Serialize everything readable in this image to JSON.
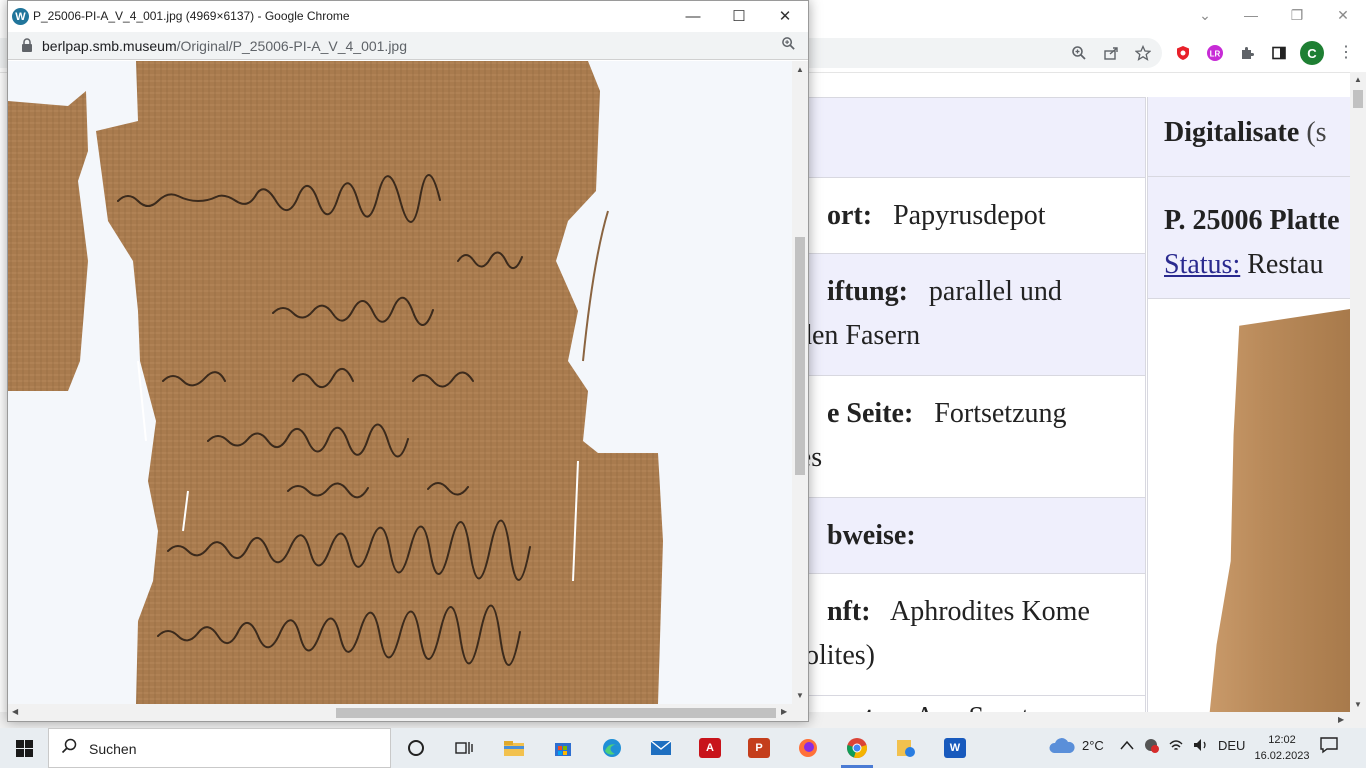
{
  "bg_window": {
    "controls": {
      "chevron": "⌄",
      "minimize": "—",
      "restore": "❐",
      "close": "✕"
    },
    "toolbar_icons": [
      "zoom-icon",
      "share-icon",
      "star-icon",
      "shield-extension-icon",
      "lr-extension-icon",
      "puzzle-icon",
      "side-panel-icon"
    ],
    "avatar_letter": "C",
    "table_rows": [
      {
        "label": "ort:",
        "value": "Papyrusdepot"
      },
      {
        "label": "iftung:",
        "value": "parallel und",
        "value2": "u den Fasern"
      },
      {
        "label": "e Seite:",
        "value": "Fortsetzung",
        "value2": "ktes"
      },
      {
        "label": "bweise:",
        "value": ""
      },
      {
        "label": "nft:",
        "value": "Aphrodites Kome",
        "value2": "opolites)"
      },
      {
        "label": "sorte:",
        "value": "Apa Surutos"
      }
    ],
    "col2": {
      "head_bold": "Digitalisate",
      "head_normal": "(s",
      "info_bold": "P. 25006 Platte",
      "status_link": "Status:",
      "status_value": "Restau"
    }
  },
  "popup": {
    "title": "P_25006-PI-A_V_4_001.jpg (4969×6137) - Google Chrome",
    "controls": {
      "minimize": "—",
      "maximize": "☐",
      "close": "✕"
    },
    "url_host": "berlpap.smb.museum",
    "url_path": "/Original/P_25006-PI-A_V_4_001.jpg"
  },
  "taskbar": {
    "search_label": "Suchen",
    "weather": "2°C",
    "language": "DEU",
    "time": "12:02",
    "date": "16.02.2023",
    "apps": [
      "cortana-icon",
      "task-view-icon",
      "file-explorer-icon",
      "store-icon",
      "edge-icon",
      "mail-icon",
      "acrobat-icon",
      "powerpoint-icon",
      "firefox-icon",
      "chrome-icon",
      "onedrive-folder-icon",
      "word-icon"
    ],
    "colors": {
      "acrobat": "#c8141b",
      "powerpoint": "#c43e1c",
      "word": "#185abd",
      "chrome_green": "#1e7f33"
    }
  }
}
